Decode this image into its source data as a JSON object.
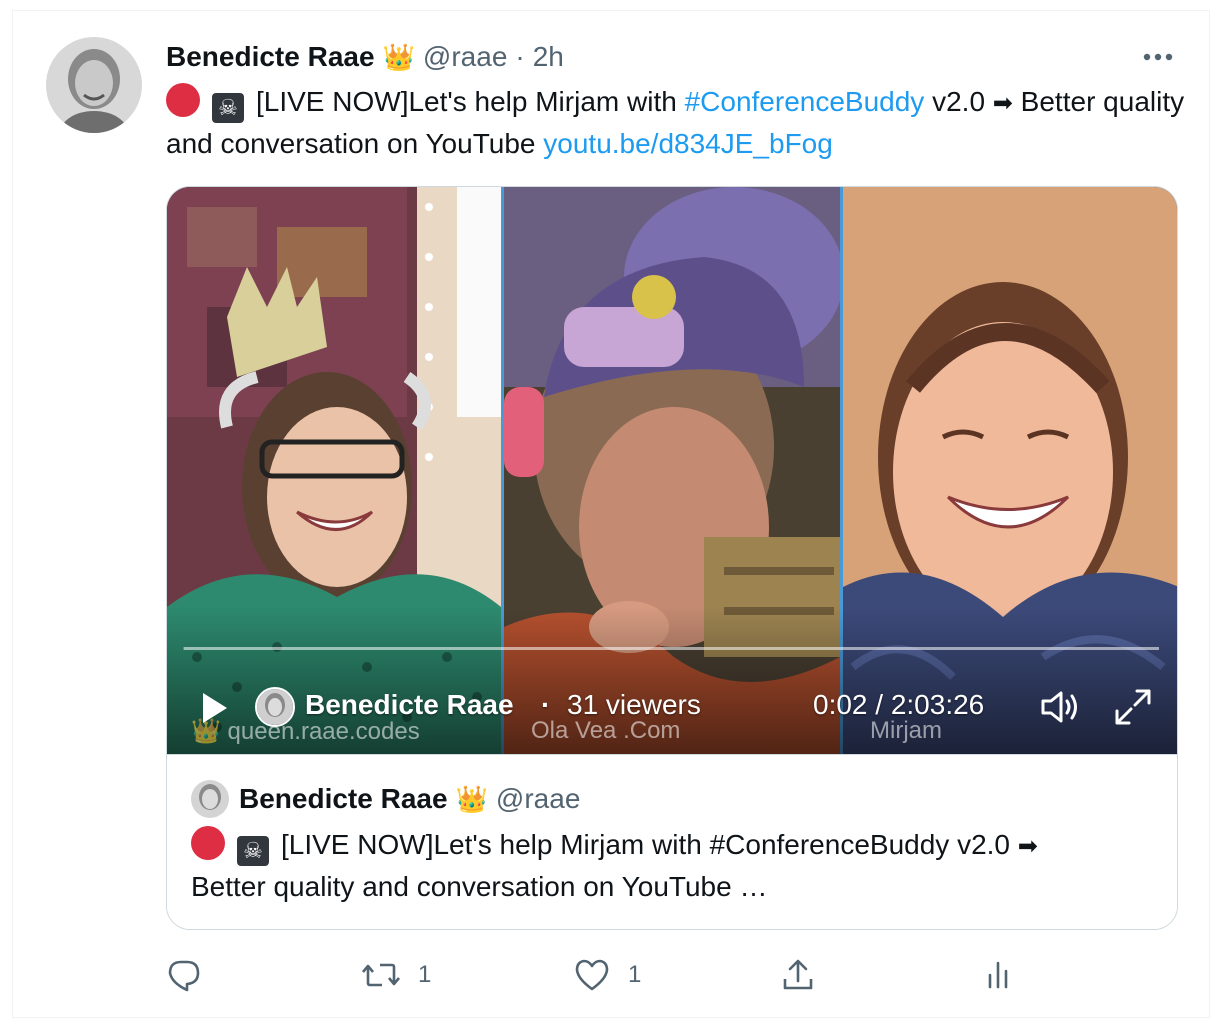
{
  "tweet": {
    "author_name": "Benedicte Raae",
    "author_emoji": "👑",
    "handle": "@raae",
    "separator": "·",
    "time": "2h",
    "text_prefix": "[LIVE NOW]Let's help Mirjam with ",
    "hashtag": "#ConferenceBuddy",
    "text_middle": " v2.0 ",
    "arrow_emoji": "➡",
    "text_suffix": " Better quality and conversation on YouTube ",
    "link": "youtu.be/d834JE_bFog",
    "pirate_emoji": "☠"
  },
  "video": {
    "streamer_name": "Benedicte Raae",
    "separator": "·",
    "viewers": "31 viewers",
    "time": "0:02 / 2:03:26",
    "progress": 0.0003,
    "captions": [
      "👑 queen.raae.codes",
      "Ola Vea .Com",
      "Mirjam"
    ]
  },
  "quoted": {
    "author_name": "Benedicte Raae",
    "author_emoji": "👑",
    "handle": "@raae",
    "line1": "[LIVE NOW]Let's help Mirjam with #ConferenceBuddy v2.0",
    "arrow_emoji": "➡",
    "line2": "Better quality and conversation on YouTube …"
  },
  "actions": {
    "reply_count": "",
    "retweet_count": "1",
    "like_count": "1"
  },
  "colors": {
    "link": "#1d9bf0",
    "muted": "#536471",
    "live_dot": "#dd2e44"
  }
}
